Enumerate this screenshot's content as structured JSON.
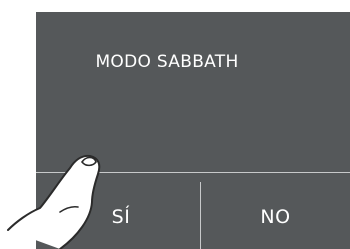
{
  "dialog": {
    "title": "MODO SABBATH"
  },
  "buttons": {
    "yes_label": "SÍ",
    "no_label": "NO"
  },
  "colors": {
    "screen_background": "#55585a",
    "text": "#ffffff",
    "divider": "#c7c9ca"
  },
  "overlay": {
    "icon": "pointing-finger-icon"
  }
}
